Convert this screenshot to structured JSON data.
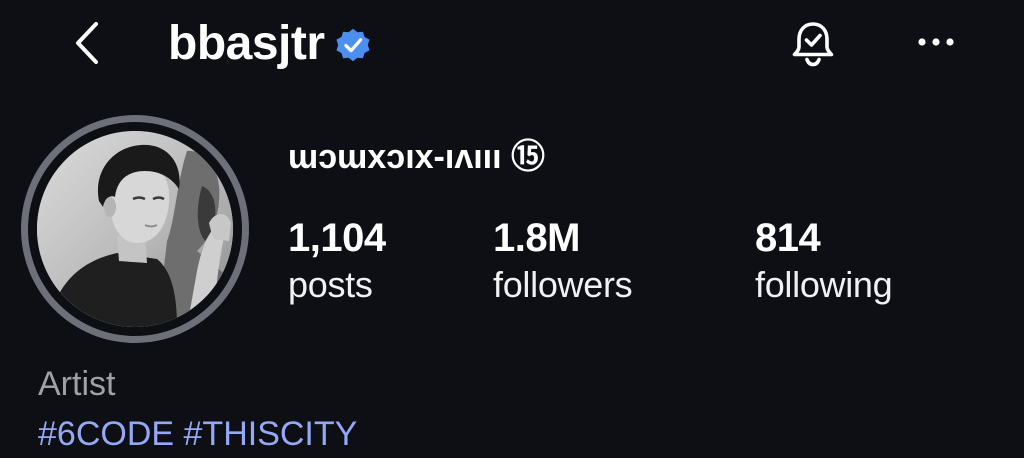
{
  "header": {
    "back_icon": "chevron-left-icon",
    "username": "bbasjtr",
    "verified_icon": "verified-badge-icon",
    "verified_color": "#4c8ff0",
    "bell_icon": "notification-bell-check-icon",
    "more_icon": "more-horizontal-icon"
  },
  "profile": {
    "display_name": "ɯɔɯxɔıx-ıʌııı ⑮",
    "avatar_description": "black-and-white profile photo",
    "stats": [
      {
        "value": "1,104",
        "label": "posts"
      },
      {
        "value": "1.8M",
        "label": "followers"
      },
      {
        "value": "814",
        "label": "following"
      }
    ]
  },
  "bio": {
    "category": "Artist",
    "hashtags": [
      "#6CODE",
      "#THISCITY"
    ],
    "hashtag_color": "#94a8f5"
  }
}
